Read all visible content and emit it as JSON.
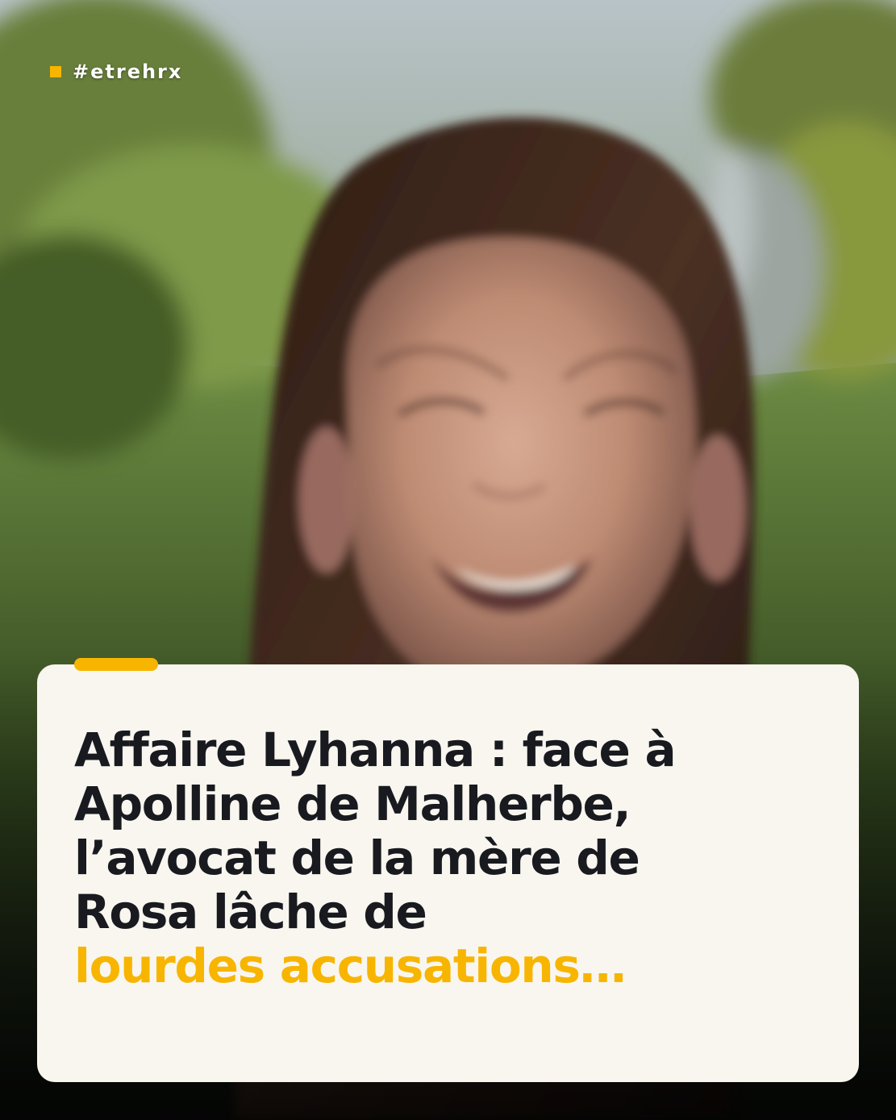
{
  "post": {
    "hashtag": "#etrehrx",
    "headline_lines": [
      "Affaire Lyhanna : face à",
      "Apolline de Malherbe,",
      "l’avocat de la mère de",
      "Rosa lâche de"
    ],
    "headline_highlight": "lourdes accusations…"
  },
  "colors": {
    "accent": "#f7b500",
    "card_background": "#f8f6ef",
    "headline_text": "#181a1f"
  },
  "icons": {
    "tag_marker": "square-icon"
  }
}
